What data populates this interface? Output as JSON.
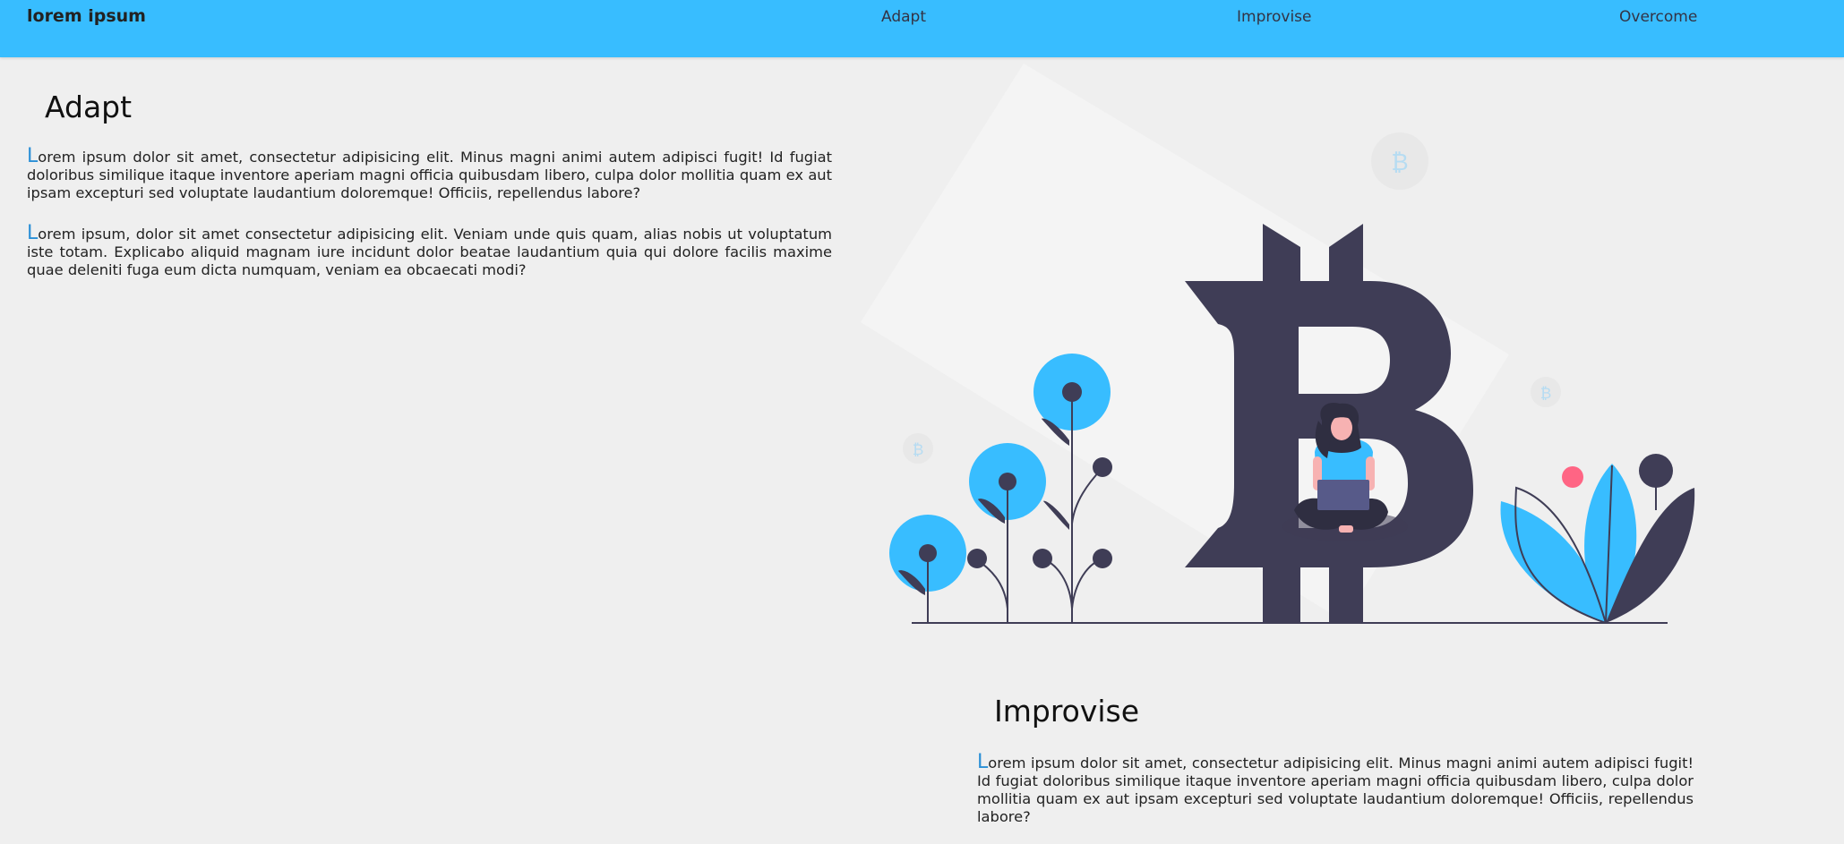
{
  "navbar": {
    "brand": "lorem ipsum",
    "links": [
      "Adapt",
      "Improvise",
      "Overcome"
    ]
  },
  "sections": {
    "adapt": {
      "title": "Adapt",
      "paragraphs": [
        {
          "cap": "L",
          "rest": "orem ipsum dolor sit amet, consectetur adipisicing elit. Minus magni animi autem adipisci fugit! Id fugiat doloribus similique itaque inventore aperiam magni officia quibusdam libero, culpa dolor mollitia quam ex aut ipsam excepturi sed voluptate laudantium doloremque! Officiis, repellendus labore?"
        },
        {
          "cap": "L",
          "rest": "orem ipsum, dolor sit amet consectetur adipisicing elit. Veniam unde quis quam, alias nobis ut voluptatum iste totam. Explicabo aliquid magnam iure incidunt dolor beatae laudantium quia qui dolore facilis maxime quae deleniti fuga eum dicta numquam, veniam ea obcaecati modi?"
        }
      ]
    },
    "improvise": {
      "title": "Improvise",
      "paragraphs": [
        {
          "cap": "L",
          "rest": "orem ipsum dolor sit amet, consectetur adipisicing elit. Minus magni animi autem adipisci fugit! Id fugiat doloribus similique itaque inventore aperiam magni officia quibusdam libero, culpa dolor mollitia quam ex aut ipsam excepturi sed voluptate laudantium doloremque! Officiis, repellendus labore?"
        }
      ]
    }
  },
  "illustration": {
    "coin_symbol": "₿"
  },
  "colors": {
    "accent": "#38bdff",
    "dark": "#3f3d56",
    "background": "#efefef",
    "dropcap": "#2a8fd6",
    "pink": "#ff6584"
  }
}
